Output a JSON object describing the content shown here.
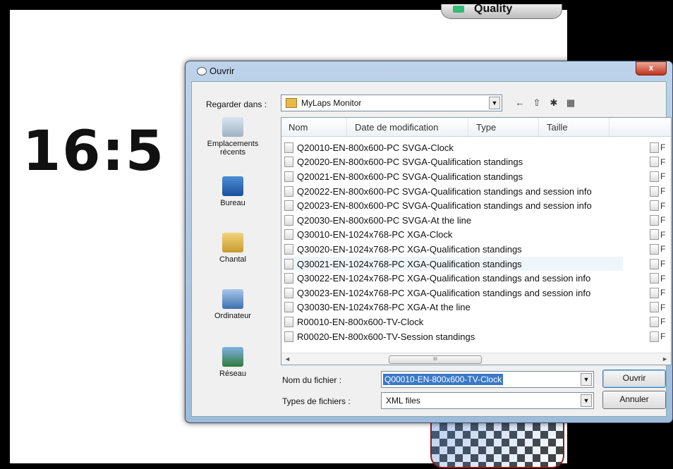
{
  "background": {
    "quality_tab_label": "Quality",
    "big_time": "16:5"
  },
  "dialog": {
    "title": "Ouvrir",
    "close_label": "x",
    "look_in_label": "Regarder dans :",
    "look_in_value": "MyLaps Monitor",
    "toolbar_icons": [
      "back-arrow-icon",
      "up-folder-icon",
      "new-folder-icon",
      "view-menu-icon"
    ],
    "places": [
      {
        "label": "Emplacements récents",
        "icon": "recent-places-icon"
      },
      {
        "label": "Bureau",
        "icon": "desktop-icon"
      },
      {
        "label": "Chantal",
        "icon": "user-folder-icon"
      },
      {
        "label": "Ordinateur",
        "icon": "computer-icon"
      },
      {
        "label": "Réseau",
        "icon": "network-icon"
      }
    ],
    "columns": {
      "name": "Nom",
      "date": "Date de modification",
      "type": "Type",
      "size": "Taille"
    },
    "files": [
      "Q20010-EN-800x600-PC SVGA-Clock",
      "Q20020-EN-800x600-PC SVGA-Qualification standings",
      "Q20021-EN-800x600-PC SVGA-Qualification standings",
      "Q20022-EN-800x600-PC SVGA-Qualification standings and session info",
      "Q20023-EN-800x600-PC SVGA-Qualification standings and session info",
      "Q20030-EN-800x600-PC SVGA-At the line",
      "Q30010-EN-1024x768-PC XGA-Clock",
      "Q30020-EN-1024x768-PC XGA-Qualification standings",
      "Q30021-EN-1024x768-PC XGA-Qualification standings",
      "Q30022-EN-1024x768-PC XGA-Qualification standings and session info",
      "Q30023-EN-1024x768-PC XGA-Qualification standings and session info",
      "Q30030-EN-1024x768-PC XGA-At the line",
      "R00010-EN-800x600-TV-Clock",
      "R00020-EN-800x600-TV-Session standings"
    ],
    "right_col_letter": "F",
    "filename_label": "Nom du fichier :",
    "filename_value": "Q00010-EN-800x600-TV-Clock",
    "filetype_label": "Types de fichiers :",
    "filetype_value": "XML files",
    "open_button": "Ouvrir",
    "cancel_button": "Annuler",
    "scroll_thumb_grip": "III"
  }
}
